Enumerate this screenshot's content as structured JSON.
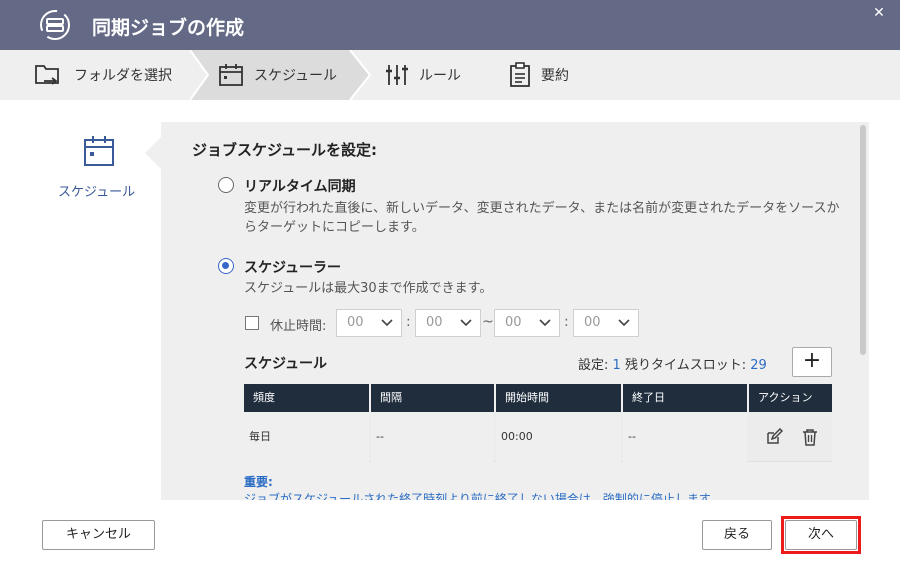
{
  "window": {
    "title": "同期ジョブの作成",
    "close_glyph": "✕"
  },
  "steps": [
    {
      "label": "フォルダを選択",
      "icon": "folder-sync-icon"
    },
    {
      "label": "スケジュール",
      "icon": "calendar-icon",
      "active": true
    },
    {
      "label": "ルール",
      "icon": "sliders-icon"
    },
    {
      "label": "要約",
      "icon": "clipboard-icon"
    }
  ],
  "rail": {
    "label": "スケジュール",
    "icon": "calendar-icon"
  },
  "panel": {
    "heading": "ジョブスケジュールを設定:",
    "realtime": {
      "title": "リアルタイム同期",
      "desc": "変更が行われた直後に、新しいデータ、変更されたデータ、または名前が変更されたデータをソースからターゲットにコピーします。",
      "selected": false
    },
    "scheduler": {
      "title": "スケジューラー",
      "desc": "スケジュールは最大30まで作成できます。",
      "selected": true
    },
    "pause": {
      "label": "休止時間:",
      "checked": false,
      "values": [
        "00",
        "00",
        "00",
        "00"
      ],
      "colon": ":",
      "tilde": "~"
    },
    "schedule": {
      "title": "スケジュール",
      "setting_label": "設定:",
      "setting_value": "1",
      "remaining_label": "残りタイムスロット:",
      "remaining_value": "29",
      "add_glyph": "+",
      "columns": [
        "頻度",
        "間隔",
        "開始時間",
        "終了日",
        "アクション"
      ],
      "rows": [
        {
          "frequency": "毎日",
          "interval": "--",
          "start": "00:00",
          "end": "--"
        }
      ]
    },
    "important": {
      "title": "重要:",
      "text": "ジョブがスケジュールされた終了時刻より前に終了しない場合は、強制的に停止します。"
    }
  },
  "footer": {
    "cancel": "キャンセル",
    "back": "戻る",
    "next": "次へ"
  },
  "colors": {
    "titlebar": "#646a86",
    "accent": "#3a66c8",
    "table_header": "#1f2d3d",
    "highlight": "#ee1b1b"
  }
}
